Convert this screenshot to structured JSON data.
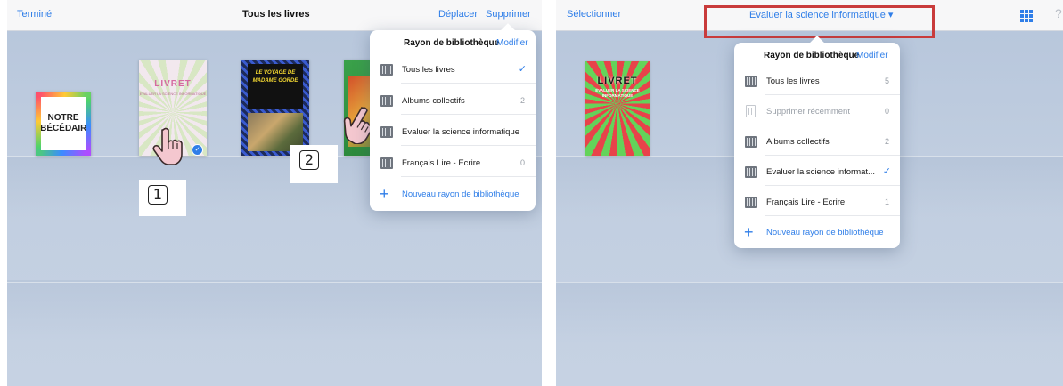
{
  "left_screen": {
    "topbar": {
      "done": "Terminé",
      "title": "Tous les livres",
      "move": "Déplacer",
      "delete": "Supprimer"
    },
    "books": [
      {
        "title_line1": "NOTRE",
        "title_line2": "ABÉCÉDAIRE"
      },
      {
        "title": "LIVRET",
        "subtitle": "EVALUER LA SCIENCE INFORMATIQUE"
      },
      {
        "title": "LE VOYAGE DE MADAME GORDE"
      },
      {
        "title": ""
      }
    ],
    "popover": {
      "header_title": "Rayon de bibliothèque",
      "header_edit": "Modifier",
      "items": [
        {
          "label": "Tous les livres",
          "count": "",
          "checked": "✓",
          "icon": "shelf-icon"
        },
        {
          "label": "Albums collectifs",
          "count": "2",
          "checked": "",
          "icon": "shelf-icon"
        },
        {
          "label": "Evaluer la science informatique",
          "count": "",
          "checked": "",
          "icon": "shelf-icon"
        },
        {
          "label": "Français Lire - Ecrire",
          "count": "0",
          "checked": "",
          "icon": "shelf-icon"
        }
      ],
      "new_shelf": "Nouveau rayon de bibliothèque"
    },
    "markers": {
      "one": "1",
      "two": "2"
    }
  },
  "right_screen": {
    "topbar": {
      "select": "Sélectionner",
      "title": "Evaluer la science informatique ▾",
      "help": "?"
    },
    "book": {
      "title": "LIVRET",
      "subtitle": "ÉVALUER LA SCIENCE INFORMATIQUE"
    },
    "popover": {
      "header_title": "Rayon de bibliothèque",
      "header_edit": "Modifier",
      "items": [
        {
          "label": "Tous les livres",
          "count": "5",
          "checked": "",
          "icon": "shelf-icon"
        },
        {
          "label": "Supprimer récemment",
          "count": "0",
          "checked": "",
          "icon": "trash-icon"
        },
        {
          "label": "Albums collectifs",
          "count": "2",
          "checked": "",
          "icon": "shelf-icon"
        },
        {
          "label": "Evaluer la science informat...",
          "count": "",
          "checked": "✓",
          "icon": "shelf-icon"
        },
        {
          "label": "Français Lire - Ecrire",
          "count": "1",
          "checked": "",
          "icon": "shelf-icon"
        }
      ],
      "new_shelf": "Nouveau rayon de bibliothèque"
    }
  },
  "colors": {
    "accent": "#2f7ee8",
    "highlight_box": "#c93b3b",
    "shelf": "#c1cee0"
  }
}
